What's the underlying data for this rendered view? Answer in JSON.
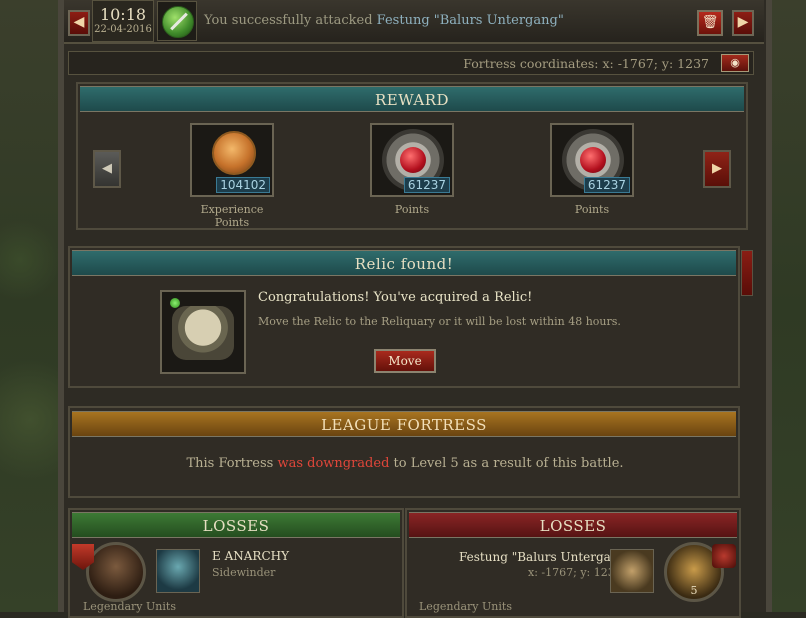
{
  "header": {
    "time": "10:18",
    "date": "22-04-2016",
    "message_prefix": "You successfully attacked",
    "target": "Festung \"Balurs Untergang\"",
    "coords_label": "Fortress coordinates: x: -1767; y: 1237"
  },
  "reward": {
    "title": "REWARD",
    "items": [
      {
        "icon": "experience-medal",
        "count": "104102",
        "label": "Experience Points"
      },
      {
        "icon": "ruby-points",
        "count": "61237",
        "label": "Points"
      },
      {
        "icon": "ruby-points",
        "count": "61237",
        "label": "Points"
      }
    ]
  },
  "relic": {
    "title": "Relic found!",
    "heading": "Congratulations! You've acquired a Relic!",
    "description": "Move the Relic to the Reliquary or it will be lost within 48 hours.",
    "move_label": "Move"
  },
  "league": {
    "title": "LEAGUE FORTRESS",
    "msg_start": "This Fortress",
    "msg_highlight": "was downgraded",
    "msg_end": "to Level 5 as a result of this battle."
  },
  "losses_left": {
    "title": "LOSSES",
    "player_name": "E ANARCHY",
    "player_sub": "Sidewinder",
    "units_label": "Legendary Units"
  },
  "losses_right": {
    "title": "LOSSES",
    "fortress_name": "Festung \"Balurs Untergang\"",
    "fortress_coords": "x: -1767; y: 1237",
    "level": "5",
    "units_label": "Legendary Units"
  },
  "colors": {
    "accent_red": "#e0463a",
    "teal_banner": "#2f6c6c",
    "orange_banner": "#a87420"
  }
}
